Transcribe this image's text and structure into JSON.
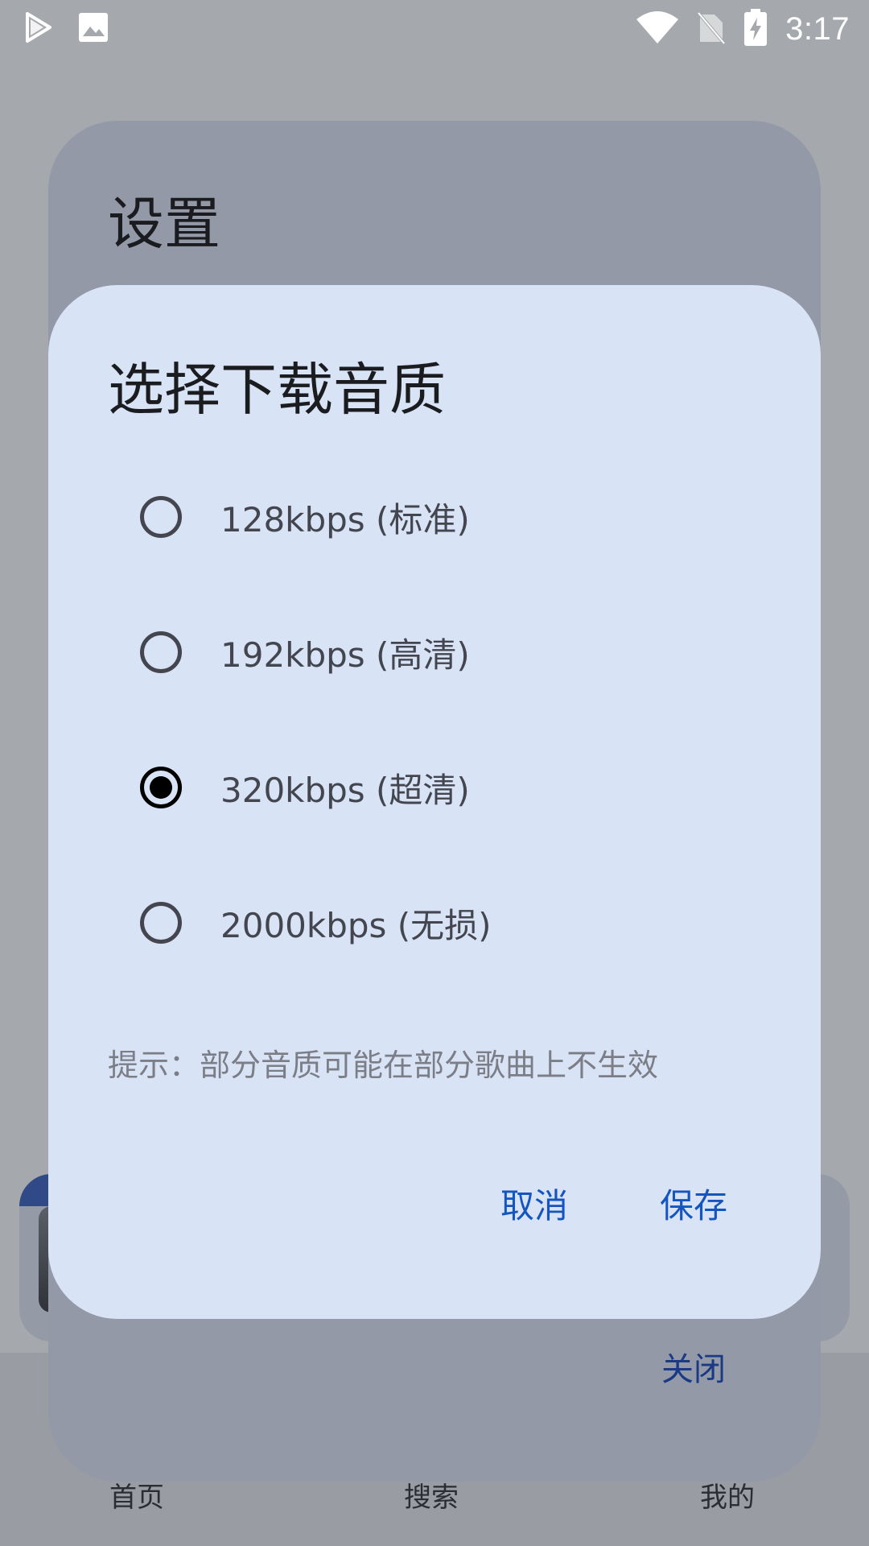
{
  "status_bar": {
    "time": "3:17",
    "left_icons": [
      "play-store-icon",
      "image-icon"
    ],
    "right_icons": [
      "wifi-icon",
      "no-sim-icon",
      "battery-charging-icon"
    ]
  },
  "background": {
    "nav": {
      "items": [
        "首页",
        "搜索",
        "我的"
      ]
    }
  },
  "settings_dialog": {
    "title": "设置",
    "close_label": "关闭"
  },
  "quality_dialog": {
    "title": "选择下载音质",
    "selected_index": 2,
    "options": [
      {
        "label": "128kbps (标准)",
        "selected": false
      },
      {
        "label": "192kbps (高清)",
        "selected": false
      },
      {
        "label": "320kbps (超清)",
        "selected": true
      },
      {
        "label": "2000kbps (无损)",
        "selected": false
      }
    ],
    "hint": "提示：部分音质可能在部分歌曲上不生效",
    "cancel_label": "取消",
    "save_label": "保存"
  },
  "colors": {
    "accent": "#1455c0",
    "dialog_bg": "#d8e3f5",
    "scrim": "#a5a8ad"
  }
}
